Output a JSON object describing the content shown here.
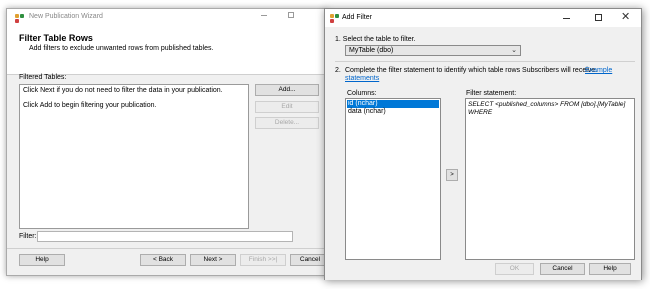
{
  "wizard": {
    "title": "New Publication Wizard",
    "heading": "Filter Table Rows",
    "subheading": "Add filters to exclude unwanted rows from published tables.",
    "filtered_tables_label": "Filtered Tables:",
    "filtered_tables_lines": [
      "Click Next if you do not need to filter the data in your publication.",
      "Click Add to begin filtering your publication."
    ],
    "buttons": {
      "add": "Add...",
      "edit": "Edit",
      "delete": "Delete...",
      "help": "Help",
      "back": "< Back",
      "next": "Next >",
      "finish": "Finish >>|",
      "cancel": "Cancel"
    },
    "filter_label": "Filter:",
    "filter_value": ""
  },
  "dialog": {
    "title": "Add Filter",
    "step1_label": "1.  Select the table to filter.",
    "table_selected": "MyTable (dbo)",
    "step2_number": "2.",
    "step2_text": "Complete the filter statement to identify which table rows Subscribers will receive.",
    "step2_link_part1": "Example",
    "step2_link_part2": "statements",
    "columns_label": "Columns:",
    "columns": [
      "id (nchar)",
      "data (nchar)"
    ],
    "selected_column_index": 0,
    "insert_button": ">",
    "statement_label": "Filter statement:",
    "statement_lines": [
      "SELECT <published_columns> FROM [dbo].[MyTable]",
      "WHERE"
    ],
    "buttons": {
      "ok": "OK",
      "cancel": "Cancel",
      "help": "Help"
    },
    "window_controls": {
      "minimize": "minimize-icon",
      "maximize": "maximize-icon",
      "close": "✕"
    }
  },
  "colors": {
    "accent": "#0078d7",
    "link": "#0066cc",
    "dialog_bg": "#f0f0f0",
    "icon_colors": [
      "#e0a030",
      "#2f8f3f",
      "#d04040"
    ]
  }
}
